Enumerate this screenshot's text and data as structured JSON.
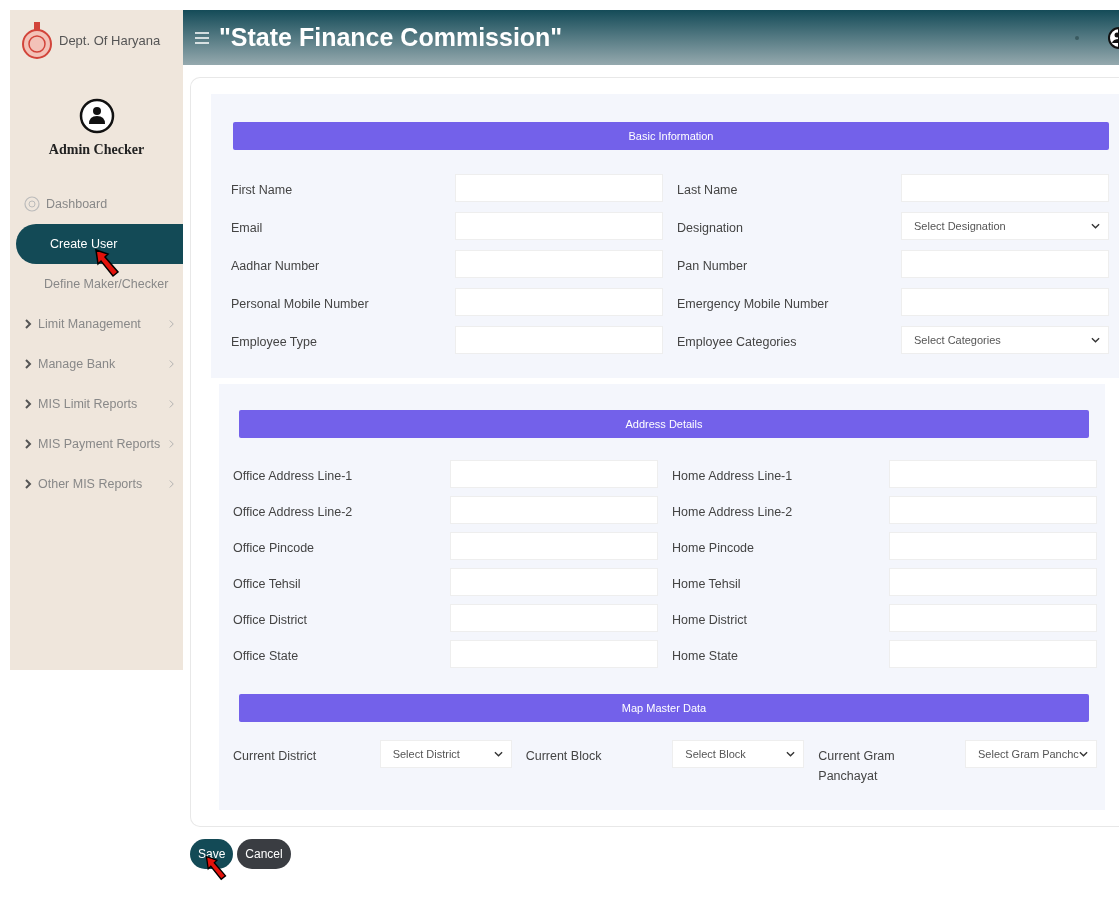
{
  "sidebar": {
    "org": "Dept. Of Haryana",
    "user": "Admin Checker",
    "items": [
      {
        "label": "Dashboard",
        "kind": "dashboard",
        "selected": false
      },
      {
        "label": "Create User",
        "kind": "link",
        "selected": true
      },
      {
        "label": "Define Maker/Checker",
        "kind": "link",
        "selected": false
      },
      {
        "label": "Limit Management",
        "kind": "submenu",
        "selected": false
      },
      {
        "label": "Manage Bank",
        "kind": "submenu",
        "selected": false
      },
      {
        "label": "MIS Limit Reports",
        "kind": "submenu",
        "selected": false
      },
      {
        "label": "MIS Payment Reports",
        "kind": "submenu",
        "selected": false
      },
      {
        "label": "Other MIS Reports",
        "kind": "submenu",
        "selected": false
      }
    ]
  },
  "header": {
    "title": "\"State Finance Commission\""
  },
  "sections": [
    {
      "title": "Basic Information",
      "kind": "basic",
      "rows": [
        [
          {
            "label": "First Name",
            "kind": "input"
          },
          {
            "label": "Last Name",
            "kind": "input"
          }
        ],
        [
          {
            "label": "Email",
            "kind": "input"
          },
          {
            "label": "Designation",
            "kind": "select",
            "placeholder": "Select Designation"
          }
        ],
        [
          {
            "label": "Aadhar Number",
            "kind": "input"
          },
          {
            "label": "Pan Number",
            "kind": "input"
          }
        ],
        [
          {
            "label": "Personal Mobile Number",
            "kind": "input"
          },
          {
            "label": "Emergency Mobile Number",
            "kind": "input"
          }
        ],
        [
          {
            "label": "Employee Type",
            "kind": "input"
          },
          {
            "label": "Employee Categories",
            "kind": "select",
            "placeholder": "Select Categories"
          }
        ]
      ]
    },
    {
      "title": "Address Details",
      "kind": "address",
      "rows": [
        [
          {
            "label": "Office Address Line-1",
            "kind": "input"
          },
          {
            "label": "Home Address Line-1",
            "kind": "input"
          }
        ],
        [
          {
            "label": "Office Address Line-2",
            "kind": "input"
          },
          {
            "label": "Home Address Line-2",
            "kind": "input"
          }
        ],
        [
          {
            "label": "Office Pincode",
            "kind": "input"
          },
          {
            "label": "Home Pincode",
            "kind": "input"
          }
        ],
        [
          {
            "label": "Office Tehsil",
            "kind": "input"
          },
          {
            "label": "Home Tehsil",
            "kind": "input"
          }
        ],
        [
          {
            "label": "Office District",
            "kind": "input"
          },
          {
            "label": "Home District",
            "kind": "input"
          }
        ],
        [
          {
            "label": "Office State",
            "kind": "input"
          },
          {
            "label": "Home State",
            "kind": "input"
          }
        ]
      ]
    },
    {
      "title": "Map Master Data",
      "kind": "map",
      "rows": [
        [
          {
            "label": "Current District",
            "kind": "select",
            "placeholder": "Select District"
          },
          {
            "label": "Current Block",
            "kind": "select",
            "placeholder": "Select Block"
          },
          {
            "label": "Current Gram Panchayat",
            "kind": "select",
            "placeholder": "Select Gram Panchc"
          }
        ]
      ]
    }
  ],
  "buttons": [
    {
      "label": "Save",
      "kind": "primary"
    },
    {
      "label": "Cancel",
      "kind": "secondary"
    }
  ]
}
